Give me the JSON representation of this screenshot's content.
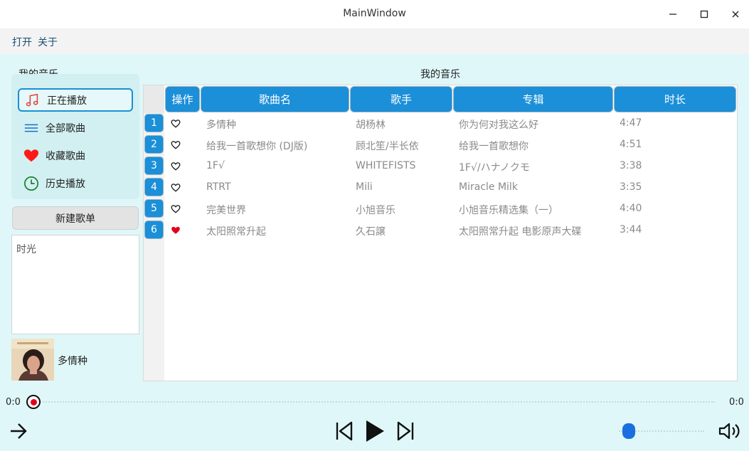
{
  "window": {
    "title": "MainWindow",
    "controls": [
      "minimize-icon",
      "maximize-icon",
      "close-icon"
    ]
  },
  "menubar": {
    "open": "打开",
    "about": "关于"
  },
  "sidebar": {
    "title": "我的音乐",
    "items": [
      {
        "label": "正在播放",
        "icon": "music-note-icon",
        "active": true
      },
      {
        "label": "全部歌曲",
        "icon": "list-icon",
        "active": false
      },
      {
        "label": "收藏歌曲",
        "icon": "heart-icon",
        "active": false
      },
      {
        "label": "历史播放",
        "icon": "clock-icon",
        "active": false
      }
    ],
    "new_playlist_label": "新建歌单",
    "playlists": [
      "时光"
    ]
  },
  "now_playing": {
    "title": "多情种"
  },
  "main": {
    "title": "我的音乐",
    "columns": [
      "操作",
      "歌曲名",
      "歌手",
      "专辑",
      "时长"
    ],
    "rows": [
      {
        "num": "1",
        "liked": false,
        "name": "多情种",
        "artist": "胡杨林",
        "album": "你为何对我这么好",
        "duration": "4:47"
      },
      {
        "num": "2",
        "liked": false,
        "name": "给我一首歌想你 (DJ版)",
        "artist": "顾北笙/半长依",
        "album": "给我一首歌想你",
        "duration": "4:51"
      },
      {
        "num": "3",
        "liked": false,
        "name": "1F√",
        "artist": "WHITEFISTS",
        "album": "1F√/ハナノクモ",
        "duration": "3:38"
      },
      {
        "num": "4",
        "liked": false,
        "name": "RTRT",
        "artist": "Mili",
        "album": "Miracle Milk",
        "duration": "3:35"
      },
      {
        "num": "5",
        "liked": false,
        "name": "完美世界",
        "artist": "小旭音乐",
        "album": "小旭音乐精选集（一）",
        "duration": "4:40"
      },
      {
        "num": "6",
        "liked": true,
        "name": "太阳照常升起",
        "artist": "久石譲",
        "album": "太阳照常升起 电影原声大碟",
        "duration": "3:44"
      }
    ]
  },
  "player": {
    "time_elapsed": "0:0",
    "time_total": "0:0",
    "progress": 0,
    "volume": 0.1
  },
  "colors": {
    "accent": "#1b8fd8",
    "background": "#dff7f8",
    "liked": "#e3001b"
  }
}
